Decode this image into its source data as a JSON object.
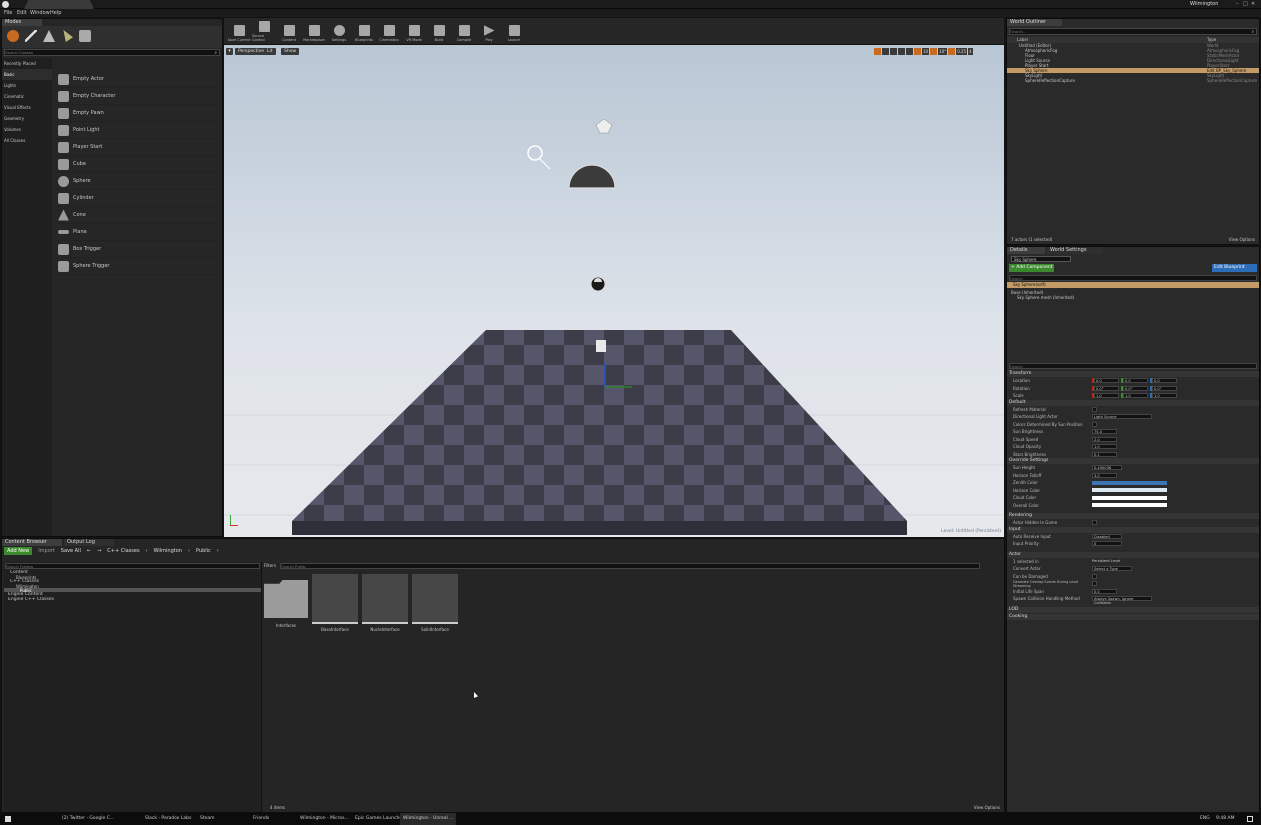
{
  "window": {
    "title": "Wilmington",
    "menus": [
      "File",
      "Edit",
      "Window",
      "Help"
    ]
  },
  "modes": {
    "tab": "Modes",
    "search_placeholder": "Search Classes"
  },
  "place": {
    "categories": [
      "Recently Placed",
      "Basic",
      "Lights",
      "Cinematic",
      "Visual Effects",
      "Geometry",
      "Volumes",
      "All Classes"
    ],
    "items": [
      "Empty Actor",
      "Empty Character",
      "Empty Pawn",
      "Point Light",
      "Player Start",
      "Cube",
      "Sphere",
      "Cylinder",
      "Cone",
      "Plane",
      "Box Trigger",
      "Sphere Trigger"
    ]
  },
  "toolbar": {
    "buttons": [
      "Save Current",
      "Source Control",
      "Content",
      "Marketplace",
      "Settings",
      "Blueprints",
      "Cinematics",
      "VR Mode",
      "Build",
      "Compile",
      "Play",
      "Launch"
    ]
  },
  "viewport": {
    "perspective": "Perspective",
    "lit": "Lit",
    "show": "Show",
    "level_label": "Level: Untitled (Persistent)",
    "camera_speed": "0.25",
    "snap_angle": "10°",
    "snap_grid": "10",
    "viewports": "4"
  },
  "outliner": {
    "tab": "World Outliner",
    "search_placeholder": "Search...",
    "col_label": "Label",
    "col_type": "Type",
    "rows": [
      {
        "label": "Untitled (Editor)",
        "type": "World"
      },
      {
        "label": "AtmosphericFog",
        "type": "AtmosphericFog"
      },
      {
        "label": "Floor",
        "type": "StaticMeshActor"
      },
      {
        "label": "Light Source",
        "type": "DirectionalLight"
      },
      {
        "label": "Player Start",
        "type": "PlayerStart"
      },
      {
        "label": "Sky Sphere",
        "type": "Edit BP_Sky_Sphere"
      },
      {
        "label": "SkyLight",
        "type": "SkyLight"
      },
      {
        "label": "SphereReflectionCapture",
        "type": "SphereReflectionCapture"
      }
    ],
    "footer_count": "7 actors (1 selected)",
    "view_options": "View Options"
  },
  "details": {
    "tab": "Details",
    "tab2": "World Settings",
    "name_value": "Sky Sphere",
    "add_component": "+ Add Component",
    "edit_blueprint": "Edit Blueprint",
    "search_placeholder": "Search",
    "self_row": "Sky Sphere(self)",
    "components": [
      "Base (Inherited)",
      "Sky Sphere mesh (Inherited)"
    ],
    "transform": {
      "title": "Transform",
      "location_label": "Location",
      "location": [
        "0.0",
        "0.0",
        "0.0"
      ],
      "rotation_label": "Rotation",
      "rotation": [
        "0.0°",
        "0.0°",
        "0.0°"
      ],
      "scale_label": "Scale",
      "scale": [
        "1.0",
        "1.0",
        "1.0"
      ]
    },
    "default_section": "Default",
    "default_props": [
      {
        "label": "Refresh Material",
        "value": ""
      },
      {
        "label": "Directional Light Actor",
        "value": "Light Source"
      },
      {
        "label": "Colors Determined By Sun Position",
        "value": ""
      },
      {
        "label": "Sun Brightness",
        "value": "75.0"
      },
      {
        "label": "Cloud Speed",
        "value": "2.0"
      },
      {
        "label": "Cloud Opacity",
        "value": "1.0"
      },
      {
        "label": "Stars Brightness",
        "value": "0.1"
      }
    ],
    "override_section": "Override Settings",
    "override_props": [
      {
        "label": "Sun Height",
        "value": "0.490036"
      },
      {
        "label": "Horizon Falloff",
        "value": "3.0"
      },
      {
        "label": "Zenith Color",
        "value": ""
      },
      {
        "label": "Horizon Color",
        "value": ""
      },
      {
        "label": "Cloud Color",
        "value": ""
      },
      {
        "label": "Overall Color",
        "value": ""
      }
    ],
    "rendering_section": "Rendering",
    "rendering_props": [
      {
        "label": "Actor Hidden In Game",
        "value": ""
      }
    ],
    "input_section": "Input",
    "input_props": [
      {
        "label": "Auto Receive Input",
        "value": "Disabled"
      },
      {
        "label": "Input Priority",
        "value": "0"
      }
    ],
    "actor_section": "Actor",
    "actor_props": [
      {
        "label": "1 selected in",
        "value": "Persistent Level"
      },
      {
        "label": "Convert Actor",
        "value": "Select a Type"
      },
      {
        "label": "Can be Damaged",
        "value": ""
      },
      {
        "label": "Generate Overlap Events During Level Streaming",
        "value": ""
      },
      {
        "label": "Initial Life Span",
        "value": "0.0"
      },
      {
        "label": "Spawn Collision Handling Method",
        "value": "Always Spawn, Ignore Collisions"
      }
    ],
    "lod_section": "LOD",
    "cooking_section": "Cooking"
  },
  "content_browser": {
    "tab": "Content Browser",
    "tab2": "Output Log",
    "add_new": "Add New",
    "import": "Import",
    "save_all": "Save All",
    "path": [
      "C++ Classes",
      "Wilmington",
      "Public"
    ],
    "folder_search_placeholder": "Search Folders",
    "filters": "Filters",
    "asset_search_placeholder": "Search Public",
    "tree": [
      "Content",
      "Blueprints",
      "C++ Classes",
      "Wilmington",
      "Public",
      "Engine Content",
      "Engine C++ Classes"
    ],
    "assets": [
      "Interfaces",
      "BaseInterface",
      "NucleInterface",
      "SolidInterface"
    ],
    "items_count": "4 items",
    "view_options": "View Options"
  },
  "taskbar": {
    "items": [
      "(2) Twitter - Google C...",
      "Slack - Paradox Labs",
      "Steam",
      "Friends",
      "Wilmington - Micros...",
      "Epic Games Launcher",
      "Wilmington - Unreal ..."
    ],
    "time": "9:48 AM",
    "lang": "ENG"
  }
}
